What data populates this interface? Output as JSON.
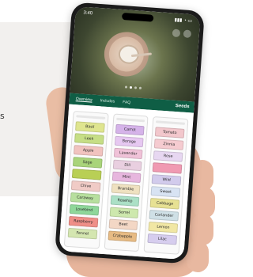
{
  "left_caption": "s",
  "statusbar": {
    "time": "3:40"
  },
  "tabs": [
    "Overview",
    "Includes",
    "FAQ"
  ],
  "app": {
    "title": "Seeds"
  },
  "carousel": {
    "slides": 4,
    "active_index": 1
  },
  "columns": [
    {
      "items": [
        {
          "label": "Basil",
          "color": "#dfe58f"
        },
        {
          "label": "Leek",
          "color": "#c6de86"
        },
        {
          "label": "Apple",
          "color": "#f1c3bf"
        },
        {
          "label": "Sage",
          "color": "#a9d47a"
        },
        {
          "label": "",
          "color": "#b9cf55"
        },
        {
          "label": "Chive",
          "color": "#f0cbc6"
        },
        {
          "label": "Caraway",
          "color": "#b7df9e"
        },
        {
          "label": "Lovebind",
          "color": "#8fd79a"
        },
        {
          "label": "Raspberry",
          "color": "#ef8f88"
        },
        {
          "label": "Fennel",
          "color": "#d4e6b0"
        }
      ]
    },
    {
      "items": [
        {
          "label": "Carrot",
          "color": "#d5b3e9"
        },
        {
          "label": "Borage",
          "color": "#e6c8f1"
        },
        {
          "label": "Lavender",
          "color": "#f0c2d8"
        },
        {
          "label": "Dill",
          "color": "#e9cfe0"
        },
        {
          "label": "Mint",
          "color": "#e7b6de"
        },
        {
          "label": "Bramble",
          "color": "#efe1c0"
        },
        {
          "label": "Rosehip",
          "color": "#abe0c6"
        },
        {
          "label": "Sorrel",
          "color": "#cde8ad"
        },
        {
          "label": "Beet",
          "color": "#f3d7c5"
        },
        {
          "label": "Crabapple",
          "color": "#e7bb84"
        }
      ]
    },
    {
      "items": [
        {
          "label": "Tomato",
          "color": "#f2c7cc"
        },
        {
          "label": "Zinnia",
          "color": "#f5cbd0"
        },
        {
          "label": "Rose",
          "color": "#e7d7f1"
        },
        {
          "label": "",
          "color": "#f09ab2"
        },
        {
          "label": "Wild",
          "color": "#d2cbec"
        },
        {
          "label": "Sweet",
          "color": "#d8e3f3"
        },
        {
          "label": "Cabbage",
          "color": "#e7e193"
        },
        {
          "label": "Coriander",
          "color": "#cfe0e6"
        },
        {
          "label": "Lemon",
          "color": "#f1e7a4"
        },
        {
          "label": "Lilac",
          "color": "#d6cdee"
        }
      ]
    }
  ],
  "colors": {
    "tabbar": "#0f5e45"
  }
}
